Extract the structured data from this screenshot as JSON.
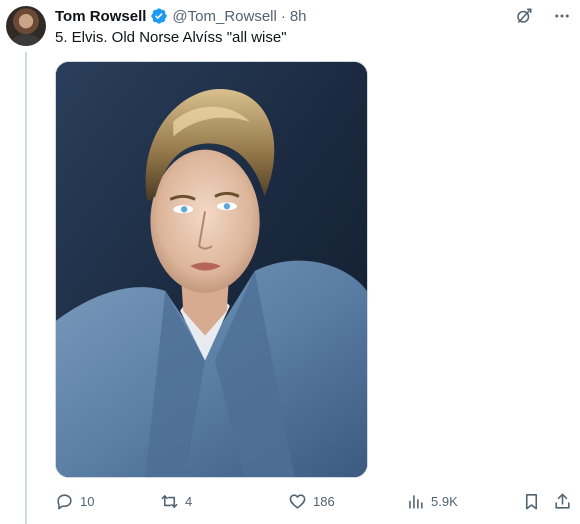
{
  "tweet": {
    "author_name": "Tom Rowsell",
    "author_handle": "@Tom_Rowsell",
    "separator": "·",
    "time_ago": "8h",
    "text": "5. Elvis. Old Norse Alvíss \"all wise\"",
    "verified": true,
    "media_alt": "Colorized portrait of Elvis Presley in a blue jacket"
  },
  "actions": {
    "replies": "10",
    "reposts": "4",
    "likes": "186",
    "views": "5.9K"
  },
  "icons": {
    "verified": "verified-badge-icon",
    "grok": "grok-icon",
    "more": "more-icon",
    "reply": "reply-icon",
    "repost": "repost-icon",
    "like": "heart-icon",
    "views": "views-icon",
    "bookmark": "bookmark-icon",
    "share": "share-icon"
  },
  "colors": {
    "text": "#0f1419",
    "secondary": "#536471",
    "verified": "#1d9bf0",
    "thread_line": "#cfd9de"
  }
}
